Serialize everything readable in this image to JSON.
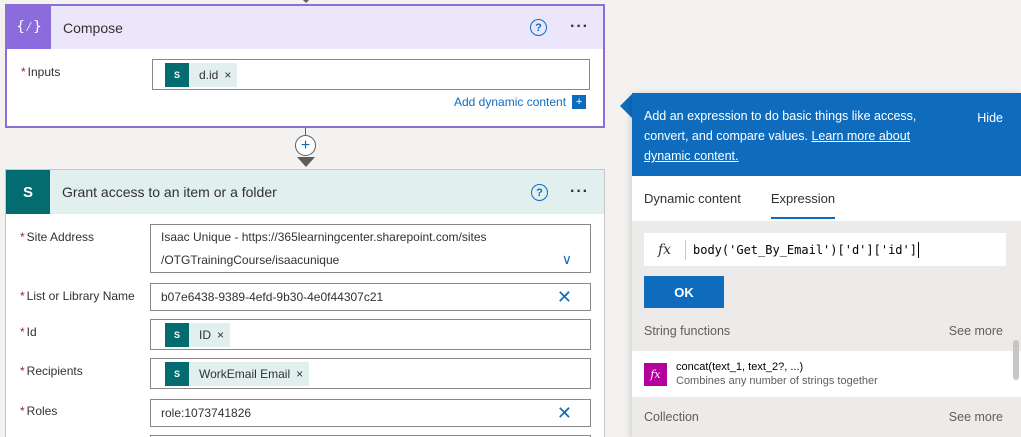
{
  "compose": {
    "title": "Compose",
    "icon_text": "{⁄}",
    "inputs_label": "Inputs",
    "inputs_token": "d.id",
    "add_dynamic": "Add dynamic content",
    "add_dynamic_plus": "+"
  },
  "grant": {
    "title": "Grant access to an item or a folder",
    "fields": {
      "site_address_label": "Site Address",
      "site_address_line1": "Isaac Unique - https://365learningcenter.sharepoint.com/sites",
      "site_address_line2": "/OTGTrainingCourse/isaacunique",
      "list_label": "List or Library Name",
      "list_value": "b07e6438-9389-4efd-9b30-4e0f44307c21",
      "id_label": "Id",
      "id_token": "ID",
      "recipients_label": "Recipients",
      "recipients_token": "WorkEmail Email",
      "roles_label": "Roles",
      "roles_value": "role:1073741826"
    }
  },
  "common": {
    "required_mark": "*",
    "token_remove": "×",
    "clear": "✕",
    "help": "?",
    "more": "···",
    "chevron": "∨",
    "sp_icon": "S"
  },
  "panel": {
    "info_text": "Add an expression to do basic things like access, convert, and compare values. ",
    "info_link": "Learn more about dynamic content.",
    "hide": "Hide",
    "tabs": [
      "Dynamic content",
      "Expression"
    ],
    "active_tab": "Expression",
    "fx": "fx",
    "expression": "body('Get_By_Email')['d']['id']",
    "ok": "OK",
    "sections": [
      {
        "title": "String functions",
        "see_more": "See more"
      },
      {
        "title": "Collection",
        "see_more": "See more"
      }
    ],
    "functions": [
      {
        "name": "concat(text_1, text_2?, ...)",
        "description": "Combines any number of strings together"
      }
    ]
  },
  "colors": {
    "compose_accent": "#8c6cdc",
    "sharepoint_teal": "#036c70",
    "primary_blue": "#0f6cbd",
    "function_magenta": "#b4009e"
  }
}
